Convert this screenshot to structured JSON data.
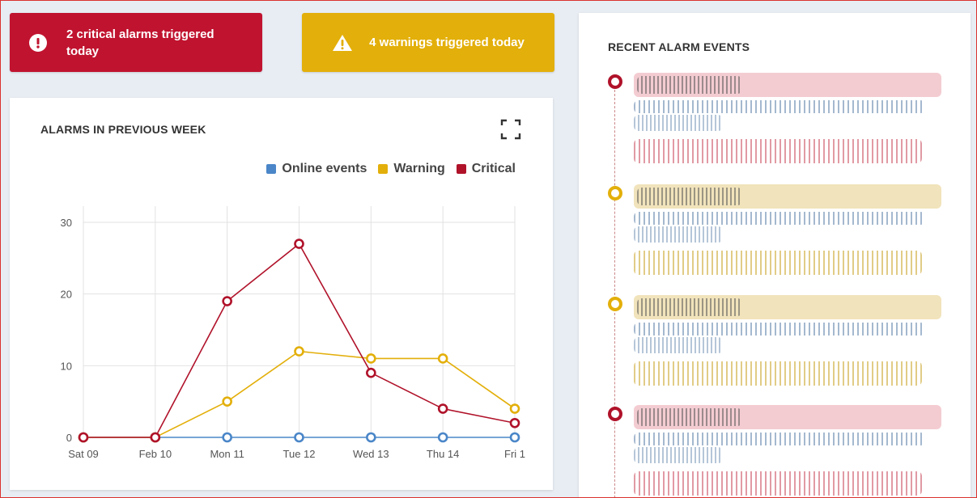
{
  "alerts": {
    "critical": {
      "text": "2 critical alarms triggered today",
      "color": "#c0132f",
      "icon": "exclamation-circle-icon"
    },
    "warning": {
      "text": "4 warnings triggered today",
      "color": "#e3af0a",
      "icon": "warning-triangle-icon"
    }
  },
  "alarms_card": {
    "title": "ALARMS IN PREVIOUS WEEK",
    "expand_icon": "expand-icon"
  },
  "events_card": {
    "title": "RECENT ALARM EVENTS",
    "events": [
      {
        "severity": "critical"
      },
      {
        "severity": "warning"
      },
      {
        "severity": "warning"
      },
      {
        "severity": "critical"
      }
    ]
  },
  "chart_data": {
    "type": "line",
    "title": "ALARMS IN PREVIOUS WEEK",
    "categories": [
      "Sat 09",
      "Feb 10",
      "Mon 11",
      "Tue 12",
      "Wed 13",
      "Thu 14",
      "Fri 1"
    ],
    "ylim": [
      0,
      30
    ],
    "yticks": [
      0,
      10,
      20,
      30
    ],
    "grid": true,
    "legend_position": "top-right",
    "series": [
      {
        "name": "Online events",
        "color": "#4a86c8",
        "values": [
          0,
          0,
          0,
          0,
          0,
          0,
          0
        ]
      },
      {
        "name": "Warning",
        "color": "#e3af0a",
        "values": [
          0,
          0,
          5,
          12,
          11,
          11,
          4
        ]
      },
      {
        "name": "Critical",
        "color": "#b0122a",
        "values": [
          0,
          0,
          19,
          27,
          9,
          4,
          2
        ]
      }
    ]
  }
}
